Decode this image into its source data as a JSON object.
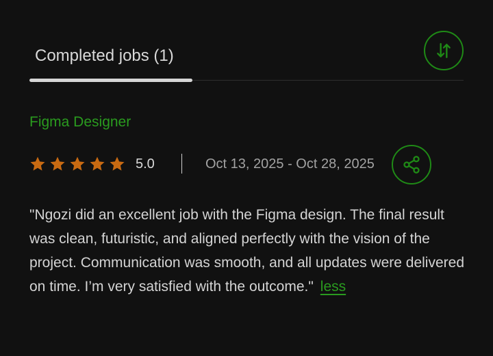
{
  "tabs": {
    "completed_label": "Completed jobs (1)"
  },
  "job": {
    "title": "Figma Designer",
    "rating": {
      "stars": 5,
      "max": 5,
      "value_label": "5.0"
    },
    "date_range": "Oct 13, 2025 - Oct 28, 2025",
    "review": "\"Ngozi did an excellent job with the Figma design. The final result was clean, futuristic, and aligned perfectly with the vision of the project. Communication was smooth, and all updates were delivered on time. I’m very satisfied with the outcome.\"",
    "less_label": "less"
  },
  "icons": {
    "sort": "sort-arrows-icon",
    "share": "share-icon",
    "star": "star-icon"
  },
  "colors": {
    "background": "#111111",
    "accent": "#2a9b1f",
    "star": "#c86a12",
    "text": "#d4d4d4",
    "muted": "#a3a3a3"
  }
}
